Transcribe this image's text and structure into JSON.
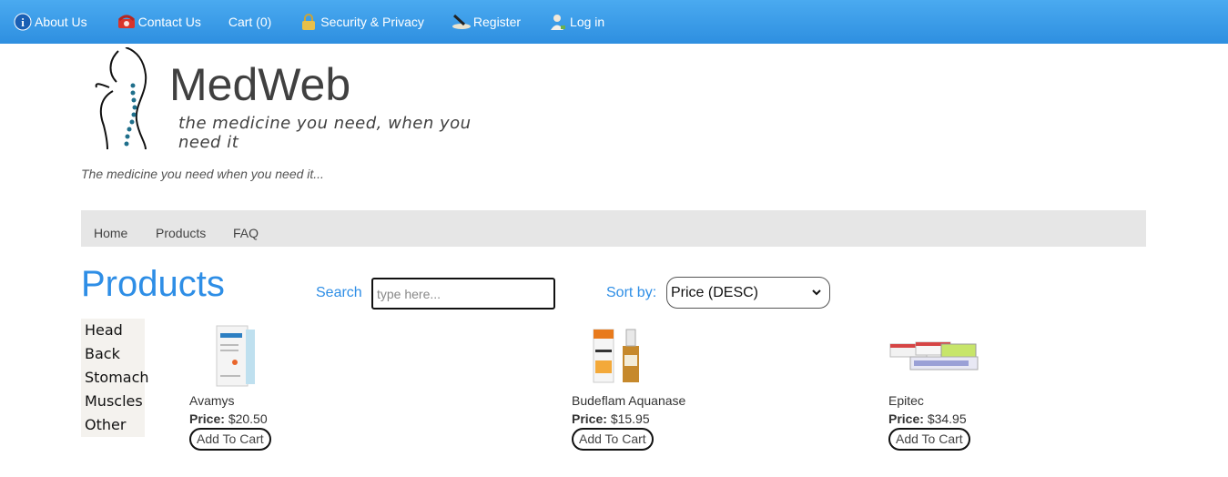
{
  "topnav": {
    "items": [
      {
        "label": "About Us",
        "icon": "info-icon"
      },
      {
        "label": "Contact Us",
        "icon": "phone-icon"
      },
      {
        "label": "Cart (0)",
        "icon": ""
      },
      {
        "label": "Security & Privacy",
        "icon": "lock-icon"
      },
      {
        "label": "Register",
        "icon": "pen-icon"
      },
      {
        "label": "Log in",
        "icon": "user-icon"
      }
    ],
    "bar_color": "#3a9be8"
  },
  "logo": {
    "title": "MedWeb",
    "tagline": "the medicine you need, when you need it"
  },
  "site_tagline": "The medicine you need when you need it...",
  "menu": {
    "items": [
      "Home",
      "Products",
      "FAQ"
    ]
  },
  "page_heading": "Products",
  "search": {
    "label": "Search",
    "placeholder": "type here..."
  },
  "sort": {
    "label": "Sort by:",
    "selected": "Price (DESC)"
  },
  "categories": [
    "Head",
    "Back",
    "Stomach",
    "Muscles",
    "Other"
  ],
  "products": [
    {
      "name": "Avamys",
      "price_label": "Price:",
      "price": "$20.50",
      "button": "Add To Cart"
    },
    {
      "name": "Budeflam Aquanase",
      "price_label": "Price:",
      "price": "$15.95",
      "button": "Add To Cart"
    },
    {
      "name": "Epitec",
      "price_label": "Price:",
      "price": "$34.95",
      "button": "Add To Cart"
    }
  ],
  "colors": {
    "accent": "#2e8ee6",
    "menubar": "#e6e6e6"
  }
}
